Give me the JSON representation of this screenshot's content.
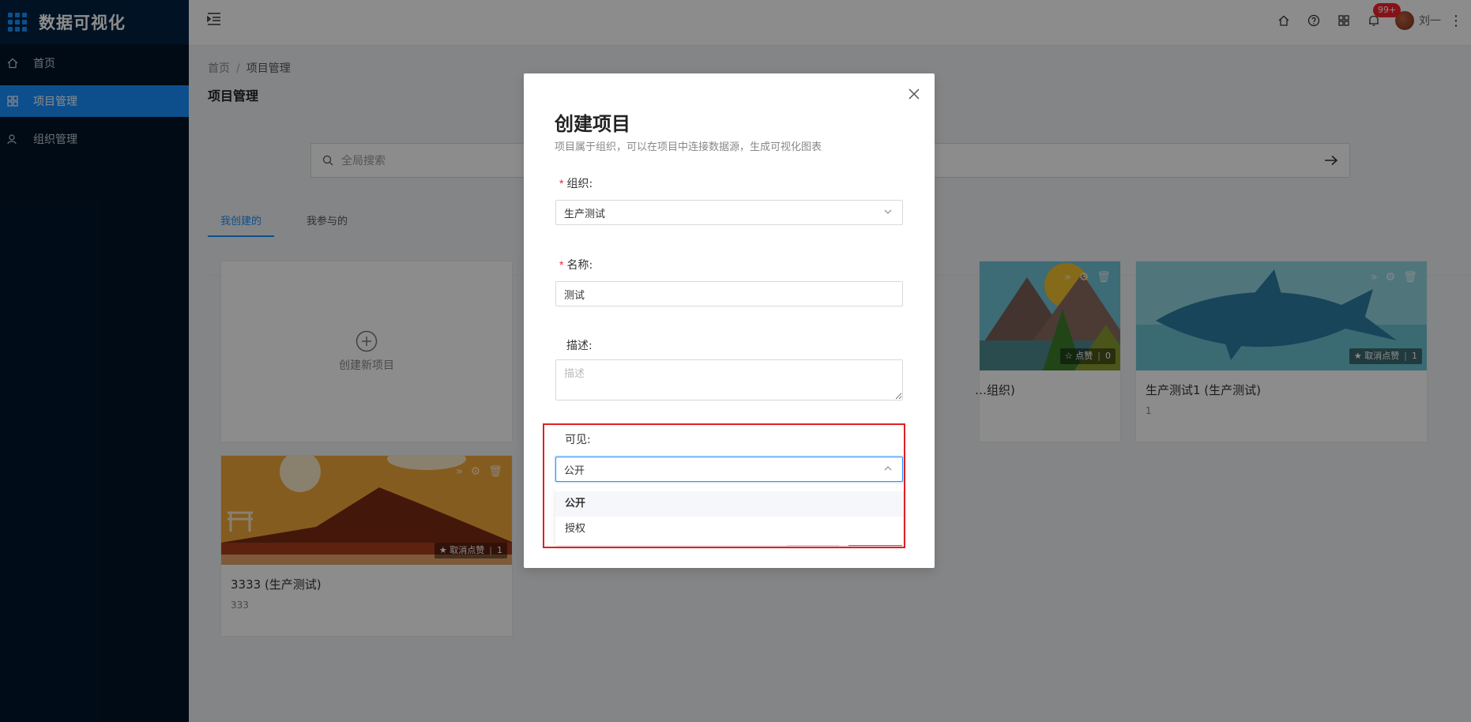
{
  "app": {
    "title": "数据可视化",
    "accent": "#1890ff"
  },
  "sidebar": {
    "items": [
      {
        "label": "首页",
        "icon": "home-icon",
        "active": false
      },
      {
        "label": "项目管理",
        "icon": "dashboard-icon",
        "active": true
      },
      {
        "label": "组织管理",
        "icon": "user-icon",
        "active": false
      }
    ]
  },
  "header": {
    "notification_count": "99+",
    "user_name": "刘一"
  },
  "breadcrumb": {
    "home": "首页",
    "current": "项目管理"
  },
  "page": {
    "title": "项目管理",
    "search_placeholder": "全局搜索",
    "tabs": [
      {
        "label": "我创建的",
        "active": true
      },
      {
        "label": "我参与的",
        "active": false
      }
    ]
  },
  "cards": {
    "new_card_label": "创建新项目",
    "items": [
      {
        "title": "…组织)",
        "sub": "",
        "like_label": "点赞",
        "like_count": "0"
      },
      {
        "title": "生产测试1 (生产测试)",
        "sub": "1",
        "like_label": "取消点赞",
        "like_count": "1"
      },
      {
        "title": "3333 (生产测试)",
        "sub": "333",
        "like_label": "取消点赞",
        "like_count": "1"
      }
    ]
  },
  "modal": {
    "title": "创建项目",
    "subtitle": "项目属于组织，可以在项目中连接数据源，生成可视化图表",
    "org_label": "组织:",
    "org_value": "生产测试",
    "name_label": "名称:",
    "name_value": "测试",
    "desc_label": "描述:",
    "desc_placeholder": "描述",
    "visibility_label": "可见:",
    "visibility_value": "公开",
    "visibility_options": [
      "公开",
      "授权"
    ]
  }
}
